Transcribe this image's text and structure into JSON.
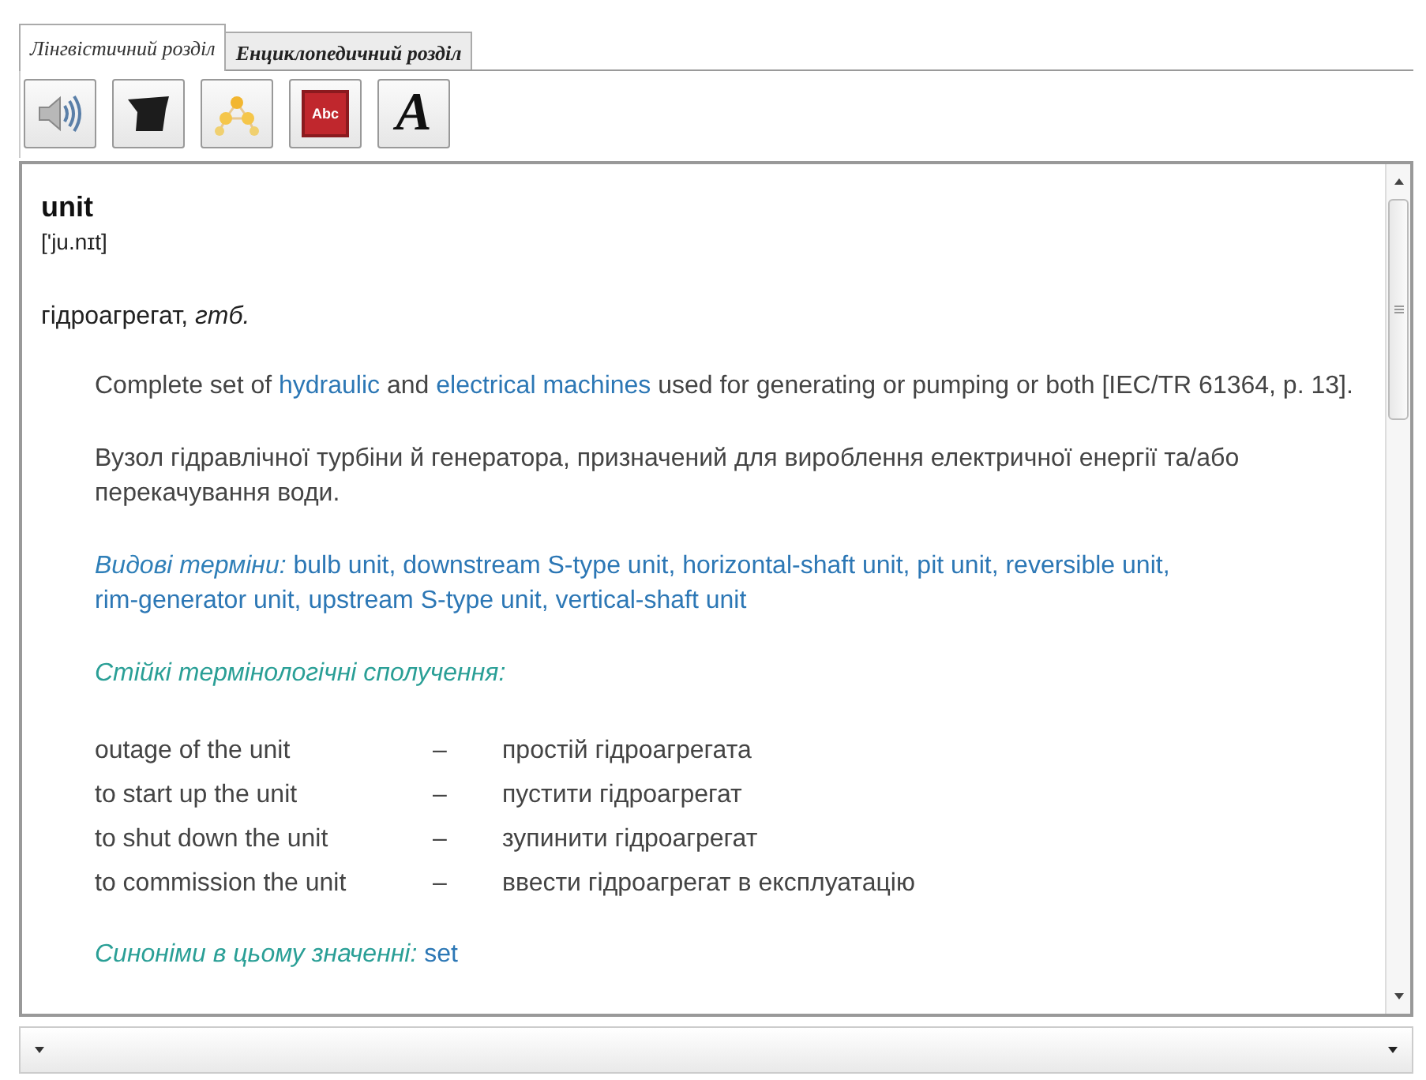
{
  "tabs": [
    {
      "label": "Лінгвістичний розділ",
      "selected": true
    },
    {
      "label": "Енциклопедичний розділ",
      "selected": false
    }
  ],
  "toolbar": [
    {
      "kind": "speaker"
    },
    {
      "kind": "cap"
    },
    {
      "kind": "network"
    },
    {
      "kind": "book",
      "text": "Abc"
    },
    {
      "kind": "font",
      "text": "A"
    }
  ],
  "entry": {
    "headword": "unit",
    "transcription": "['ju.nɪt]",
    "translation": "гідроагрегат, *гтб.*",
    "definition": [
      {
        "kind": "plain",
        "text": "Complete set of "
      },
      {
        "kind": "link",
        "text": "hydraulic"
      },
      {
        "kind": "plain",
        "text": " and "
      },
      {
        "kind": "link",
        "text": "electrical machines"
      },
      {
        "kind": "plain",
        "text": " used for generating or pumping or both [IEC/TR 61364, p. 13]."
      }
    ],
    "definition_uk": "Вузол гідравлічної турбіни й генератора, призначений для вироблення електричної енергії та/або перекачування води.",
    "species_label": "Видові терміни:",
    "separator": ",",
    "species_terms": [
      "bulb unit",
      "downstream S-type unit",
      "horizontal-shaft unit",
      "pit unit",
      "reversible unit",
      "rim-generator unit",
      "upstream S-type unit",
      "vertical-shaft unit"
    ],
    "phrases_label": "Стійкі термінологічні сполучення:",
    "phrases": [
      {
        "en": "outage of the unit",
        "dash": "–",
        "uk": "простій гідроагрегата"
      },
      {
        "en": "to start up the unit",
        "dash": "–",
        "uk": "пустити гідроагрегат"
      },
      {
        "en": "to shut down the unit",
        "dash": "–",
        "uk": "зупинити гідроагрегат"
      },
      {
        "en": "to commission the unit",
        "dash": "–",
        "uk": "ввести гідроагрегат в експлуатацію"
      }
    ],
    "synonyms_label": "Синоніми в цьому значенні:",
    "synonyms": [
      "set"
    ]
  }
}
